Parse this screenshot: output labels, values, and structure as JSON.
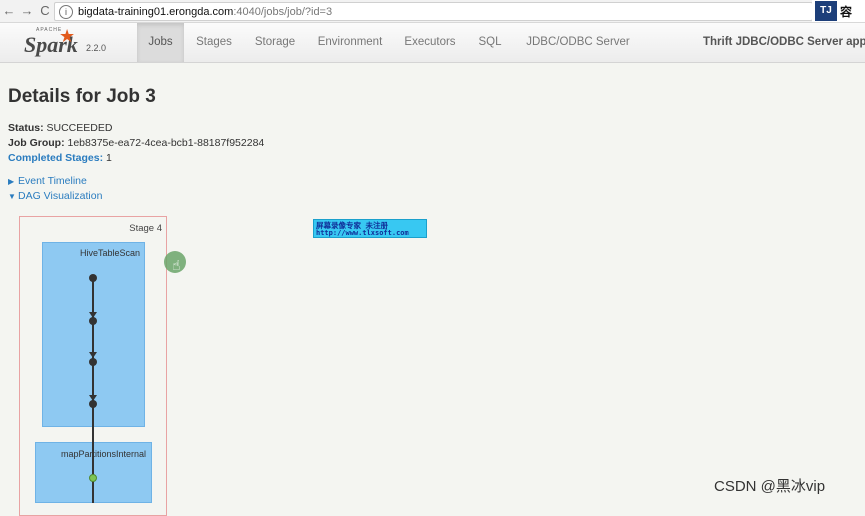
{
  "browser": {
    "back": "←",
    "forward": "→",
    "reload": "C",
    "info": "i",
    "url_domain": "bigdata-training01.erongda.com",
    "url_path": ":4040/jobs/job/?id=3",
    "ext_mark": "TJ",
    "ext_text": "容"
  },
  "navbar": {
    "brand_apache": "APACHE",
    "brand_name": "Spark",
    "brand_version": "2.2.0",
    "tabs": [
      "Jobs",
      "Stages",
      "Storage",
      "Environment",
      "Executors",
      "SQL",
      "JDBC/ODBC Server"
    ],
    "active_tab": "Jobs",
    "app_name": "Thrift JDBC/ODBC Server appl"
  },
  "page": {
    "title": "Details for Job 3",
    "status_label": "Status:",
    "status_value": "SUCCEEDED",
    "job_group_label": "Job Group:",
    "job_group_value": "1eb8375e-ea72-4cea-bcb1-88187f952284",
    "completed_stages_label": "Completed Stages:",
    "completed_stages_value": "1",
    "event_timeline": "Event Timeline",
    "dag_visualization": "DAG Visualization"
  },
  "dag": {
    "stage_label": "Stage 4",
    "clusters": [
      "HiveTableScan",
      "mapPartitionsInternal"
    ]
  },
  "watermark": {
    "line1": "屏幕录像专家      未注册",
    "line2": "http://www.tlxsoft.com"
  },
  "footer": {
    "csdn": "CSDN @黑冰vip"
  }
}
